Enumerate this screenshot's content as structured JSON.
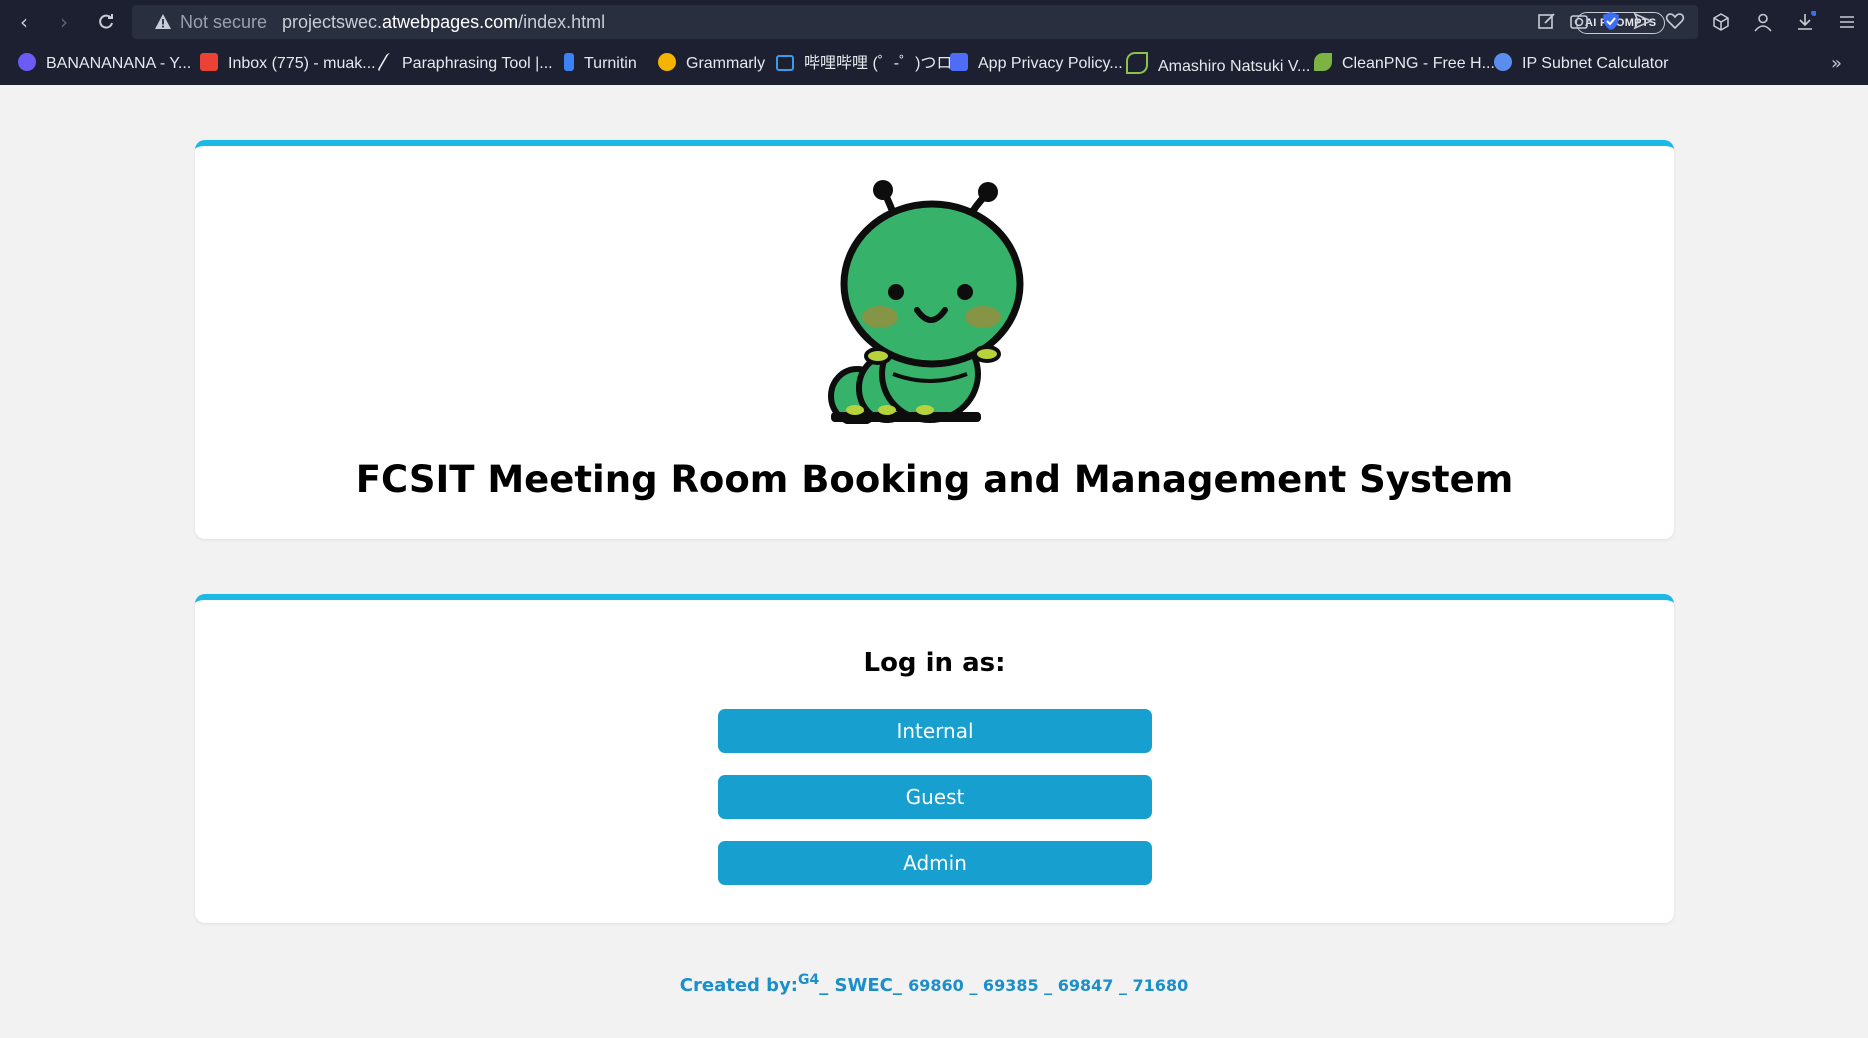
{
  "browser": {
    "security_label": "Not secure",
    "url_prefix": "projectswec.",
    "url_domain": "atwebpages.com",
    "url_path": "/index.html",
    "ai_prompts_label": "AI PROMPTS",
    "bookmarks": [
      {
        "label": "BANANANANA - Y...",
        "icon": "c-circle-icon",
        "color": "#6b5cf6"
      },
      {
        "label": "Inbox (775) - muak...",
        "icon": "gmail-icon",
        "color": "#ea4335"
      },
      {
        "label": "Paraphrasing Tool |...",
        "icon": "quill-icon",
        "color": "#e6e8ee"
      },
      {
        "label": "Turnitin",
        "icon": "turnitin-icon",
        "color": "#3b82f6"
      },
      {
        "label": "Grammarly",
        "icon": "grammarly-icon",
        "color": "#f5b400"
      },
      {
        "label": "哔哩哔哩 (゜-゜)つロ...",
        "icon": "bilibili-icon",
        "color": "#3b9be8"
      },
      {
        "label": "App Privacy Policy...",
        "icon": "shield-u-icon",
        "color": "#4e6cf5"
      },
      {
        "label": "Amashiro Natsuki V...",
        "icon": "leaf-outline-icon",
        "color": "#8bc34a"
      },
      {
        "label": "CleanPNG - Free H...",
        "icon": "leaf-icon",
        "color": "#7cb342"
      },
      {
        "label": "IP Subnet Calculator",
        "icon": "globe-icon",
        "color": "#5b8def"
      }
    ]
  },
  "header": {
    "title": "FCSIT Meeting Room Booking and Management System",
    "logo_icon": "caterpillar-mascot-icon"
  },
  "login": {
    "heading": "Log in as:",
    "buttons": [
      "Internal",
      "Guest",
      "Admin"
    ]
  },
  "footer": {
    "created_by": "Created by:",
    "group": "G4",
    "team": "_ SWEC_",
    "ids": "69860 _ 69385 _ 69847 _ 71680"
  },
  "colors": {
    "accent": "#1ab9e6",
    "button": "#179fcf",
    "footer_text": "#1a8fc9",
    "chrome_bg": "#1c2030"
  }
}
